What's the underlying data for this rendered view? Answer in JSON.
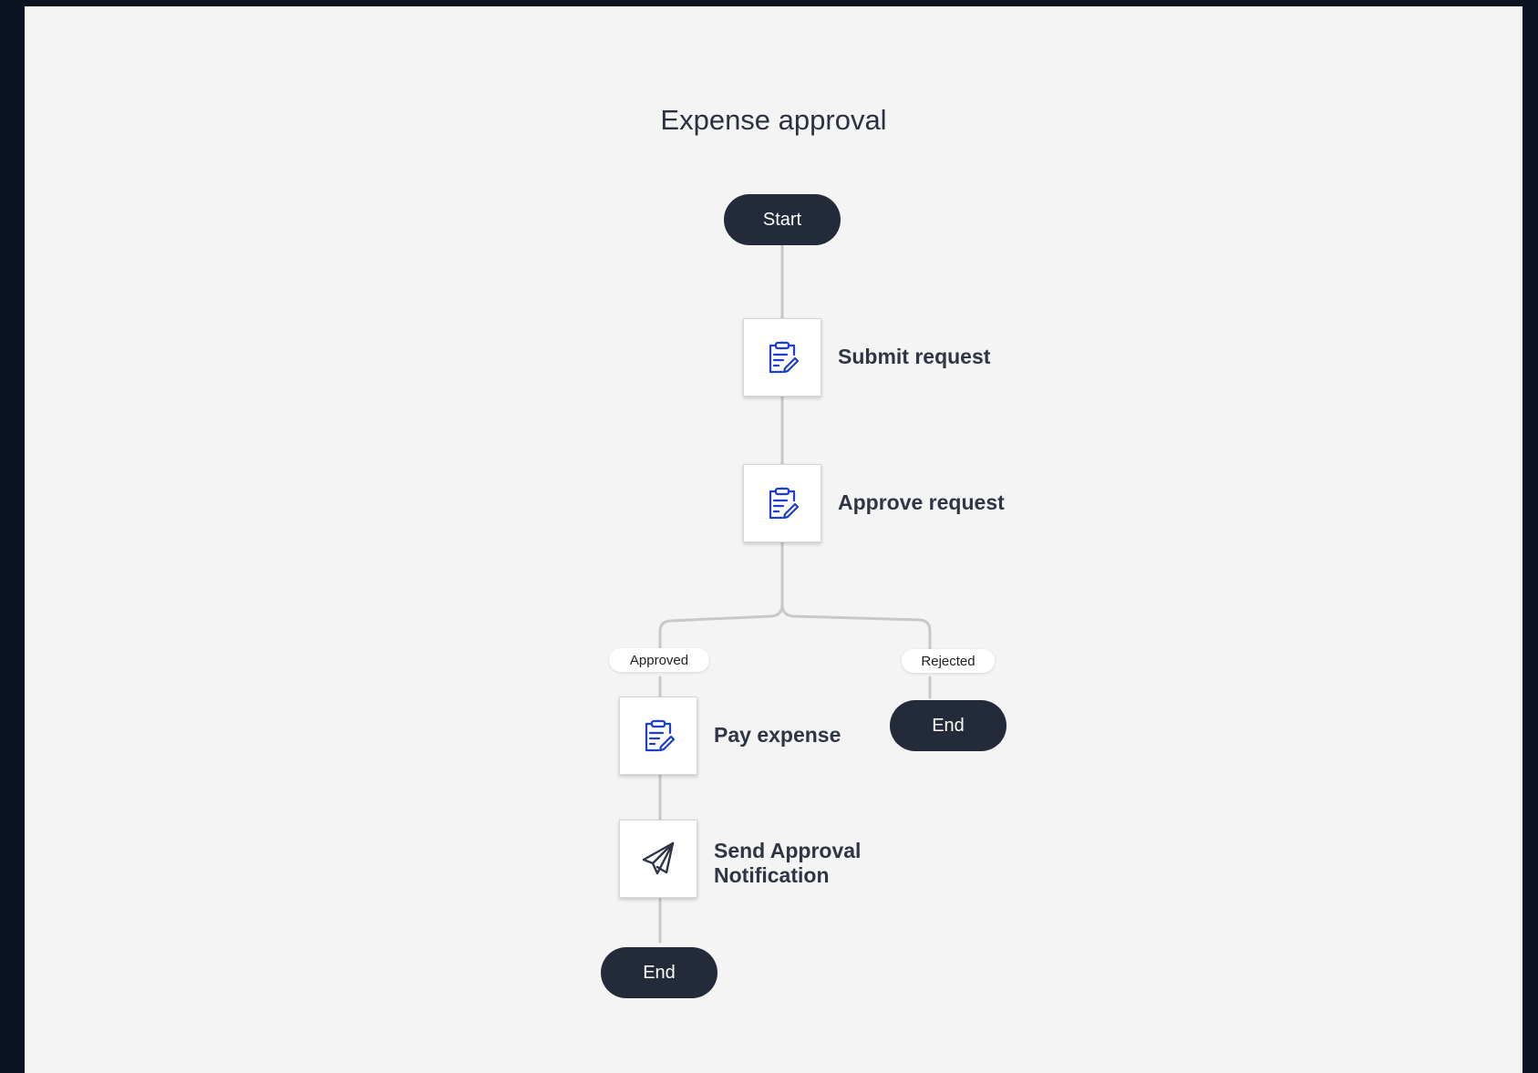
{
  "workflow": {
    "title": "Expense approval",
    "start_label": "Start",
    "steps": {
      "submit": {
        "label": "Submit request",
        "icon": "clipboard-edit-icon"
      },
      "approve": {
        "label": "Approve request",
        "icon": "clipboard-edit-icon"
      },
      "pay": {
        "label": "Pay expense",
        "icon": "clipboard-edit-icon"
      },
      "notify": {
        "label_line1": "Send Approval",
        "label_line2": "Notification",
        "icon": "paper-plane-icon"
      }
    },
    "branches": {
      "approved": "Approved",
      "rejected": "Rejected"
    },
    "end_label_rejected": "End",
    "end_label_approved": "End"
  },
  "colors": {
    "background": "#f4f4f4",
    "frame": "#0b1222",
    "pill": "#232a3a",
    "connector": "#c8c8c8",
    "task_icon": "#1d3fd1",
    "send_icon": "#2f3545"
  }
}
